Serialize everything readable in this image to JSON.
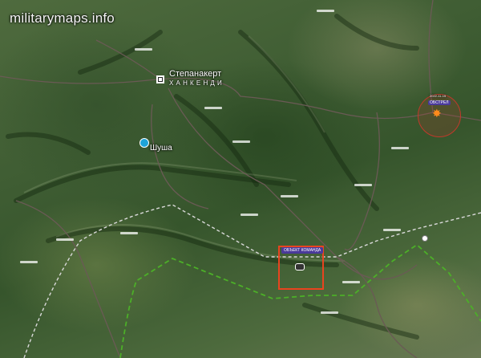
{
  "watermark": "militarymaps.info",
  "cities": {
    "main_name": "Степанакерт",
    "main_alt_name": "ХАНКЕНДИ",
    "shusha": "Шуша"
  },
  "markers": {
    "target_label": "ОБЪЕКТ КОМАНДА",
    "blast_label": "ОБСТРЕЛ",
    "blast_date": "2022-11-15"
  },
  "lines": {
    "border_color": "#4caf28",
    "contact_color": "#d9d9d9",
    "road_color": "#6a5a55"
  },
  "icons": {
    "city": "city-square-icon",
    "shusha": "landmark-pin-icon",
    "target": "target-frame-icon",
    "blast": "explosion-star-icon"
  }
}
